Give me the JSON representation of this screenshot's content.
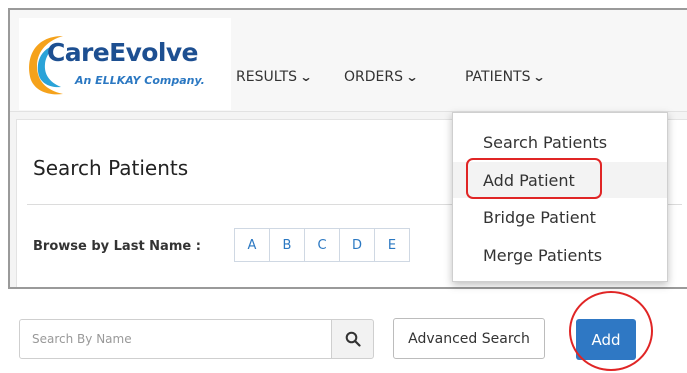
{
  "brand": {
    "name": "CareEvolve",
    "tagline": "An ELLKAY Company."
  },
  "nav": [
    {
      "label": "RESULTS"
    },
    {
      "label": "ORDERS"
    },
    {
      "label": "PATIENTS"
    }
  ],
  "page": {
    "title": "Search Patients",
    "browse_label": "Browse by Last Name :"
  },
  "alphabet": [
    "A",
    "B",
    "C",
    "D",
    "E"
  ],
  "patients_menu": [
    {
      "label": "Search Patients"
    },
    {
      "label": "Add Patient"
    },
    {
      "label": "Bridge Patient"
    },
    {
      "label": "Merge Patients"
    }
  ],
  "search": {
    "placeholder": "Search By Name",
    "icon": "search-icon"
  },
  "buttons": {
    "advanced_search": "Advanced Search",
    "add": "Add"
  },
  "colors": {
    "brand_blue": "#1d4f91",
    "accent_blue": "#2f78c4",
    "highlight_red": "#e02525",
    "logo_orange": "#f5a21b"
  }
}
